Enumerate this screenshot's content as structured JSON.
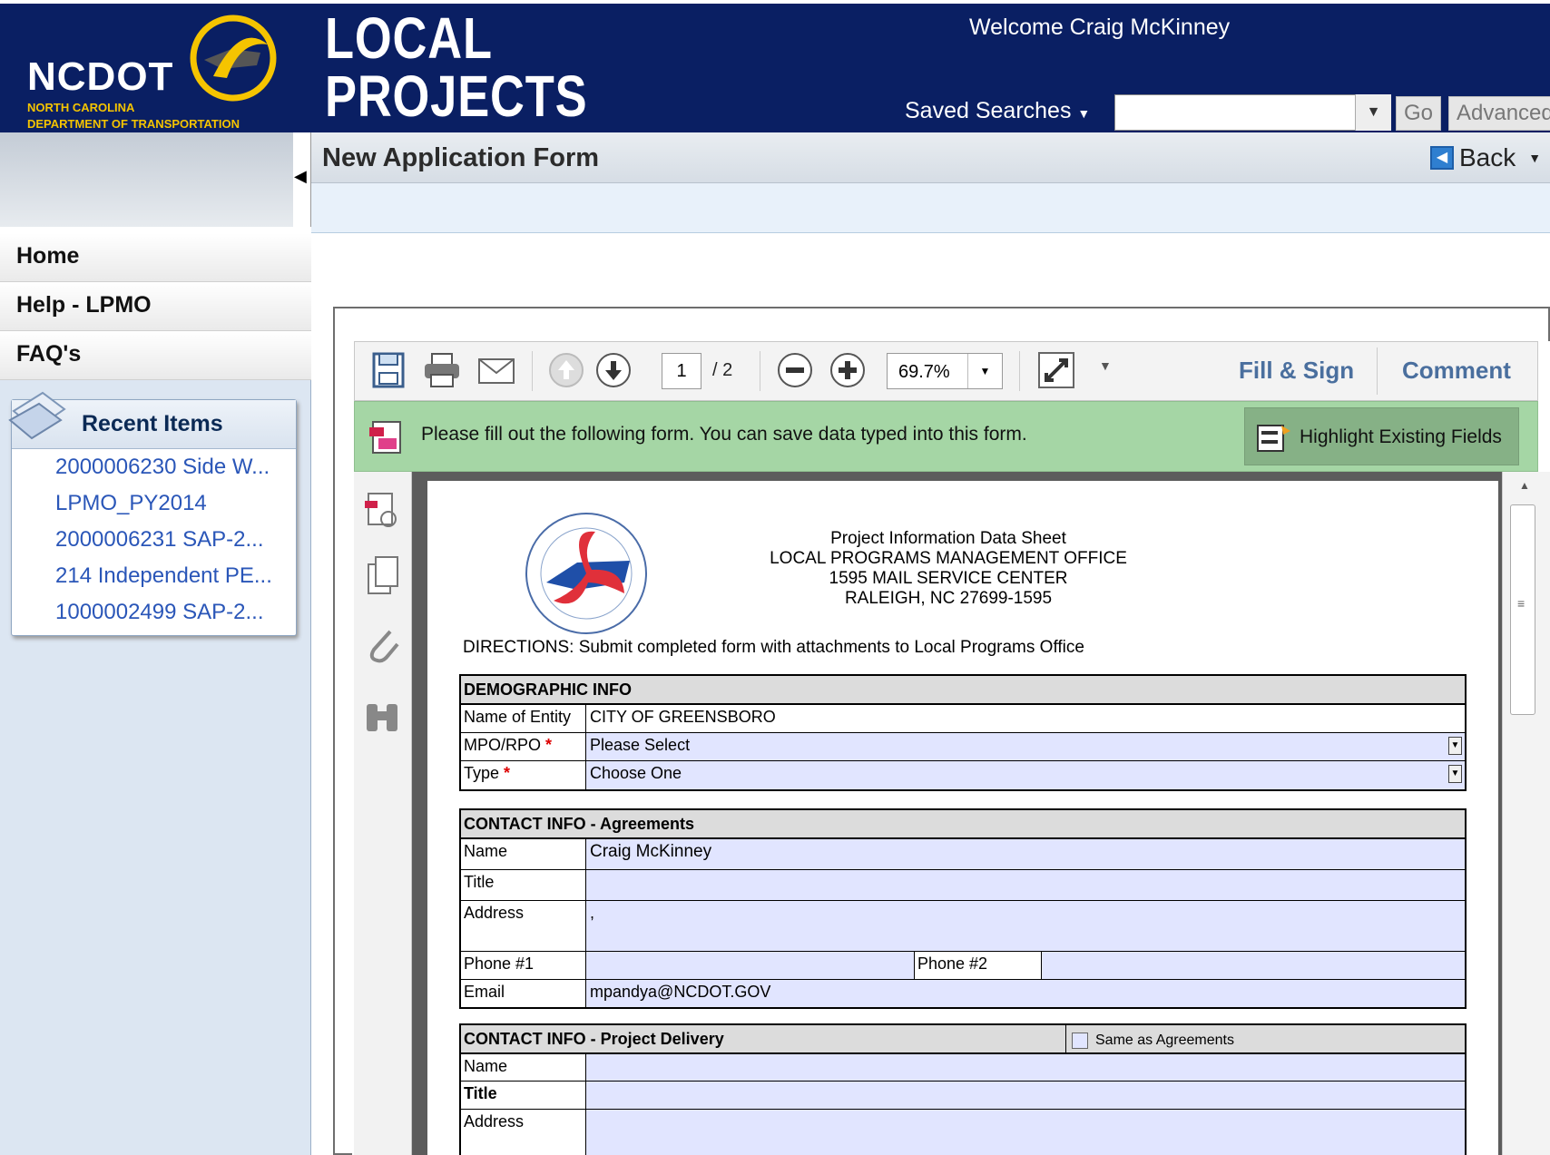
{
  "header": {
    "logo_text": "NCDOT",
    "logo_subtitle_line1": "NORTH CAROLINA",
    "logo_subtitle_line2": "DEPARTMENT OF TRANSPORTATION",
    "app_title_line1": "LOCAL",
    "app_title_line2": "PROJECTS",
    "welcome": "Welcome Craig McKinney",
    "saved_searches": "Saved Searches",
    "search_value": "",
    "go_label": "Go",
    "advanced_label": "Advanced"
  },
  "titlebar": {
    "title": "New Application Form",
    "back_label": "Back"
  },
  "nav": {
    "items": [
      "Home",
      "Help - LPMO",
      "FAQ's"
    ]
  },
  "recent": {
    "title": "Recent Items",
    "items": [
      "2000006230 Side W...",
      "LPMO_PY2014",
      "2000006231 SAP-2...",
      "214 Independent PE...",
      "1000002499 SAP-2..."
    ]
  },
  "pdf_toolbar": {
    "page_current": "1",
    "page_total": "/ 2",
    "zoom": "69.7%",
    "fill_sign": "Fill & Sign",
    "comment": "Comment"
  },
  "infobar": {
    "message": "Please fill out the following form. You can save data typed into this form.",
    "highlight_button": "Highlight Existing Fields"
  },
  "form": {
    "heading1": "Project Information Data Sheet",
    "heading2": "LOCAL PROGRAMS MANAGEMENT OFFICE",
    "heading3": "1595 MAIL SERVICE CENTER",
    "heading4": "RALEIGH, NC 27699-1595",
    "directions": "DIRECTIONS: Submit completed form with attachments to Local Programs Office",
    "demographic": {
      "title": "DEMOGRAPHIC INFO",
      "entity_label": "Name of Entity",
      "entity_value": "CITY OF GREENSBORO",
      "mpo_label": "MPO/RPO",
      "mpo_value": "Please Select",
      "type_label": "Type",
      "type_value": "Choose One",
      "required_mark": "*"
    },
    "agreements": {
      "title": "CONTACT INFO - Agreements",
      "name_label": "Name",
      "name_value": "Craig McKinney",
      "title_label": "Title",
      "title_value": "",
      "address_label": "Address",
      "address_value": ",",
      "phone1_label": "Phone #1",
      "phone1_value": "",
      "phone2_label": "Phone #2",
      "phone2_value": "",
      "email_label": "Email",
      "email_value": "mpandya@NCDOT.GOV"
    },
    "delivery": {
      "title": "CONTACT INFO - Project Delivery",
      "same_as_label": "Same as Agreements",
      "same_as_checked": false,
      "name_label": "Name",
      "title_label": "Title",
      "address_label": "Address"
    }
  }
}
